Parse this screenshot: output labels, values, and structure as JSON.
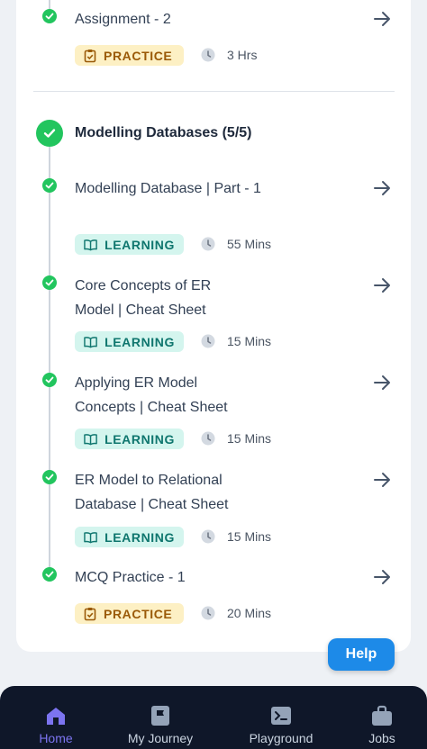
{
  "modules": [
    {
      "type": "item",
      "title": "Assignment - 2",
      "badge": "PRACTICE",
      "badge_kind": "practice",
      "duration": "3 Hrs"
    }
  ],
  "section": {
    "title": "Modelling Databases (5/5)",
    "items": [
      {
        "title": "Modelling Database | Part - 1",
        "badge": "LEARNING",
        "badge_kind": "learning",
        "duration": "55 Mins"
      },
      {
        "title": "Core Concepts of ER Model | Cheat Sheet",
        "badge": "LEARNING",
        "badge_kind": "learning",
        "duration": "15 Mins"
      },
      {
        "title": "Applying ER Model Concepts | Cheat Sheet",
        "badge": "LEARNING",
        "badge_kind": "learning",
        "duration": "15 Mins"
      },
      {
        "title": "ER Model to Relational Database | Cheat Sheet",
        "badge": "LEARNING",
        "badge_kind": "learning",
        "duration": "15 Mins"
      },
      {
        "title": "MCQ Practice - 1",
        "badge": "PRACTICE",
        "badge_kind": "practice",
        "duration": "20 Mins"
      }
    ]
  },
  "help_label": "Help",
  "nav": [
    {
      "label": "Home",
      "icon": "home-icon",
      "active": true
    },
    {
      "label": "My Journey",
      "icon": "journey-flag-icon",
      "active": false
    },
    {
      "label": "Playground",
      "icon": "terminal-icon",
      "active": false
    },
    {
      "label": "Jobs",
      "icon": "briefcase-icon",
      "active": false
    }
  ],
  "colors": {
    "success": "#22c55e",
    "practice_bg": "#fdf0c4",
    "practice_text": "#9a5a08",
    "learning_bg": "#d4f5ee",
    "learning_text": "#0f766e",
    "help_button": "#1d8ae8",
    "nav_bg": "#0f1729",
    "nav_active": "#7c74f0"
  }
}
